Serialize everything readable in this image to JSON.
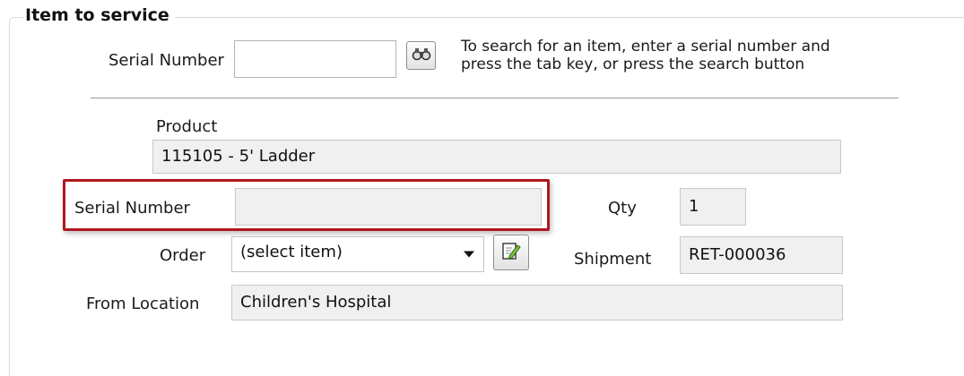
{
  "group": {
    "title": "Item to service"
  },
  "search": {
    "serial_label": "Serial Number",
    "serial_value": "",
    "button_icon": "binoculars-icon",
    "hint_line1": "To search for an item, enter a serial number and",
    "hint_line2": "press the tab key, or press the search button"
  },
  "details": {
    "product_label": "Product",
    "product_value": "115105 - 5' Ladder",
    "serial_label": "Serial Number",
    "serial_value": "",
    "qty_label": "Qty",
    "qty_value": "1",
    "order_label": "Order",
    "order_selected": "(select item)",
    "order_edit_icon": "edit-icon",
    "shipment_label": "Shipment",
    "shipment_value": "RET-000036",
    "from_location_label": "From Location",
    "from_location_value": "Children's Hospital"
  },
  "colors": {
    "highlight": "#b0171d",
    "readonly_bg": "#f0f0f0"
  }
}
